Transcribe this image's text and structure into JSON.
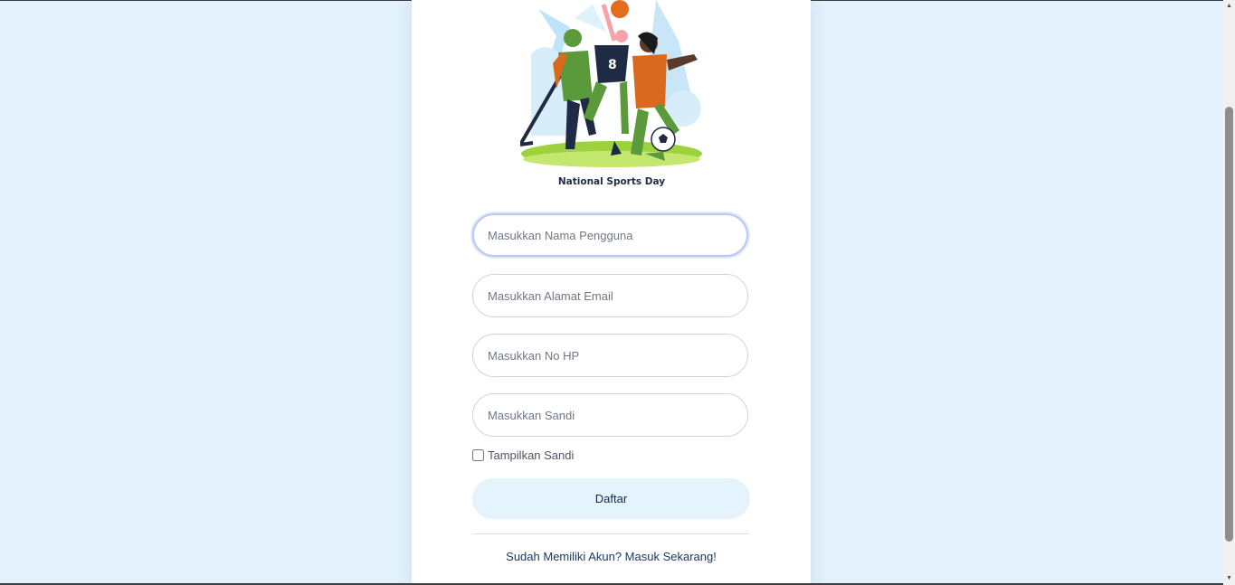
{
  "illustration": {
    "caption": "National Sports Day",
    "jersey_number": "8"
  },
  "form": {
    "username_placeholder": "Masukkan Nama Pengguna",
    "email_placeholder": "Masukkan Alamat Email",
    "phone_placeholder": "Masukkan No HP",
    "password_placeholder": "Masukkan Sandi",
    "show_password_label": "Tampilkan Sandi",
    "submit_label": "Daftar"
  },
  "footer": {
    "login_link": "Sudah Memiliki Akun? Masuk Sekarang!"
  },
  "colors": {
    "page_background": "#e3f2fc",
    "card_background": "#ffffff",
    "button_background": "#e5f3fc",
    "link_color": "#1a3866"
  },
  "icons": {
    "scroll_up": "scroll-up-arrow-icon",
    "scroll_down": "scroll-down-arrow-icon"
  }
}
